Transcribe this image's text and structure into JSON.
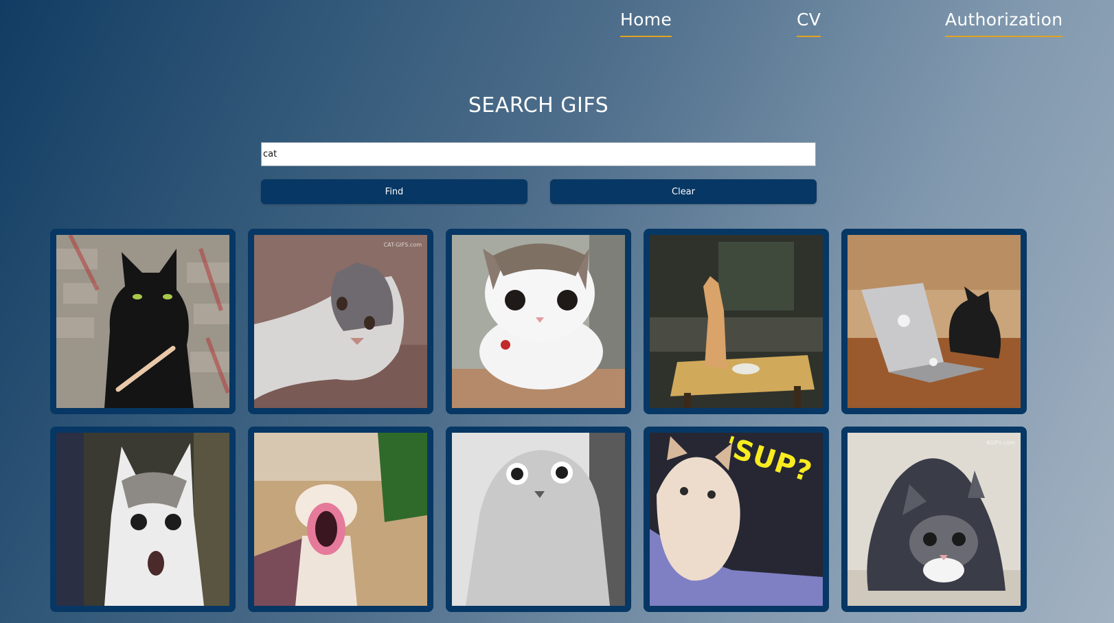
{
  "nav": {
    "home": "Home",
    "cv": "CV",
    "authorization": "Authorization"
  },
  "header": {
    "title": "SEARCH GIFS"
  },
  "search": {
    "value": "cat",
    "find_label": "Find",
    "clear_label": "Clear"
  },
  "results": [
    {
      "subject": "black cat with nail file",
      "bg": "#8f887c",
      "fg": "#181818"
    },
    {
      "subject": "gray white cat lunging",
      "bg": "#8b6e68",
      "fg": "#e9e5e3",
      "watermark": "CAT-GIFS.com"
    },
    {
      "subject": "white cat staring",
      "bg": "#9aa096",
      "fg": "#f6f6f6"
    },
    {
      "subject": "ginger cat on kitchen table",
      "bg": "#3a3d34",
      "fg": "#d6a064"
    },
    {
      "subject": "cat with laptop",
      "bg": "#a06c3f",
      "fg": "#1b1b1b"
    },
    {
      "subject": "shocked white cat",
      "bg": "#3a3a32",
      "fg": "#e7e7e7"
    },
    {
      "subject": "cat with lips filter",
      "bg": "#b79a72",
      "fg": "#f2e9e2"
    },
    {
      "subject": "surprised gray cat",
      "bg": "#bdbdbd",
      "fg": "#8a8a8a"
    },
    {
      "subject": "kitten saying sup",
      "bg": "#2a2b38",
      "fg": "#e8d5c0",
      "caption": "'SUP?"
    },
    {
      "subject": "tabby cat crouching",
      "bg": "#d9d4cc",
      "fg": "#3e3f48",
      "watermark": "4GIFs.com"
    }
  ],
  "colors": {
    "accent": "#e3a31b",
    "button": "#073764",
    "card_border": "#073764"
  }
}
